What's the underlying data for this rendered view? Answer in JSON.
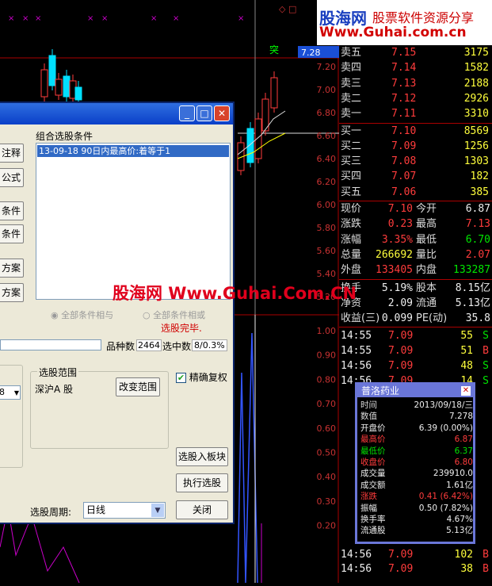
{
  "logo": {
    "cn": "股海网",
    "tagline": "股票软件资源分享",
    "url": "Www.Guhai.com.cn"
  },
  "chart": {
    "price_labels": [
      "7.20",
      "7.00",
      "6.80",
      "6.60",
      "6.40",
      "6.20",
      "6.00",
      "5.80",
      "5.60",
      "5.40",
      "5.20"
    ],
    "vol_labels": [
      "1.00",
      "0.90",
      "0.80",
      "0.70",
      "0.60",
      "0.50",
      "0.40",
      "0.30",
      "0.20"
    ],
    "signal": "突",
    "cursor_price": "7.28",
    "colors": {
      "up": "#ff3c3c",
      "down": "#00e0ff",
      "axis": "#c83232"
    }
  },
  "quote": {
    "asks": [
      {
        "label": "卖五",
        "price": "7.15",
        "vol": "3175"
      },
      {
        "label": "卖四",
        "price": "7.14",
        "vol": "1582"
      },
      {
        "label": "卖三",
        "price": "7.13",
        "vol": "2188"
      },
      {
        "label": "卖二",
        "price": "7.12",
        "vol": "2926"
      },
      {
        "label": "卖一",
        "price": "7.11",
        "vol": "3310"
      }
    ],
    "bids": [
      {
        "label": "买一",
        "price": "7.10",
        "vol": "8569"
      },
      {
        "label": "买二",
        "price": "7.09",
        "vol": "1256"
      },
      {
        "label": "买三",
        "price": "7.08",
        "vol": "1303"
      },
      {
        "label": "买四",
        "price": "7.07",
        "vol": "182"
      },
      {
        "label": "买五",
        "price": "7.06",
        "vol": "385"
      }
    ],
    "stats": [
      {
        "l1": "现价",
        "v1": "7.10",
        "l2": "今开",
        "v2": "6.87",
        "c1": "red",
        "c2": "wht"
      },
      {
        "l1": "涨跌",
        "v1": "0.23",
        "l2": "最高",
        "v2": "7.13",
        "c1": "red",
        "c2": "red"
      },
      {
        "l1": "涨幅",
        "v1": "3.35%",
        "l2": "最低",
        "v2": "6.70",
        "c1": "red",
        "c2": "grn"
      },
      {
        "l1": "总量",
        "v1": "266692",
        "l2": "量比",
        "v2": "2.07",
        "c1": "yel",
        "c2": "red"
      },
      {
        "l1": "外盘",
        "v1": "133405",
        "l2": "内盘",
        "v2": "133287",
        "c1": "red",
        "c2": "grn"
      }
    ],
    "stats2": [
      {
        "l1": "换手",
        "v1": "5.19%",
        "l2": "股本",
        "v2": "8.15亿"
      },
      {
        "l1": "净资",
        "v1": "2.09",
        "l2": "流通",
        "v2": "5.13亿"
      },
      {
        "l1": "收益(三)",
        "v1": "0.099",
        "l2": "PE(动)",
        "v2": "35.8"
      }
    ],
    "ticks": [
      {
        "time": "14:55",
        "price": "7.09",
        "vol": "55",
        "bs": "S"
      },
      {
        "time": "14:55",
        "price": "7.09",
        "vol": "51",
        "bs": "B"
      },
      {
        "time": "14:56",
        "price": "7.09",
        "vol": "48",
        "bs": "S"
      },
      {
        "time": "14:56",
        "price": "7.09",
        "vol": "14",
        "bs": "S"
      },
      {
        "time": "14:56",
        "price": "7.09",
        "vol": "102",
        "bs": "B"
      },
      {
        "time": "14:56",
        "price": "7.09",
        "vol": "38",
        "bs": "B"
      }
    ]
  },
  "dialog": {
    "buttons_left": [
      "注释",
      "公式",
      "条件",
      "条件",
      "方案",
      "方案"
    ],
    "cond_label": "组合选股条件",
    "cond_item": "13-09-18 90日内最高价:着等于1",
    "radio1": "全部条件相与",
    "radio2": "全部条件相或",
    "done": "选股完毕.",
    "count_label": "品种数",
    "count_value": "2464",
    "selected_label": "选中数",
    "selected_value": "8/0.3%",
    "partial_select": "8",
    "range_group": "选股范围",
    "range_value": "深沪A 股",
    "change_range": "改变范围",
    "exact_adjust": "精确复权",
    "add_block": "选股入板块",
    "run": "执行选股",
    "close": "关闭",
    "period_label": "选股周期:",
    "period_value": "日线"
  },
  "popup": {
    "title": "普洛药业",
    "rows": [
      {
        "k": "时间",
        "v": "2013/09/18/三",
        "c": "wht"
      },
      {
        "k": "数值",
        "v": "7.278",
        "c": "wht"
      },
      {
        "k": "开盘价",
        "v": "6.39 (0.00%)",
        "c": "wht"
      },
      {
        "k": "最高价",
        "v": "6.87",
        "c": "red"
      },
      {
        "k": "最低价",
        "v": "6.37",
        "c": "grn"
      },
      {
        "k": "收盘价",
        "v": "6.80",
        "c": "red"
      },
      {
        "k": "成交量",
        "v": "239910.0",
        "c": "wht"
      },
      {
        "k": "成交额",
        "v": "1.61亿",
        "c": "wht"
      },
      {
        "k": "涨跌",
        "v": "0.41 (6.42%)",
        "c": "red"
      },
      {
        "k": "振幅",
        "v": "0.50 (7.82%)",
        "c": "wht"
      },
      {
        "k": "换手率",
        "v": "4.67%",
        "c": "wht"
      },
      {
        "k": "流通股",
        "v": "5.13亿",
        "c": "wht"
      }
    ]
  },
  "watermark": "股海网 Www.Guhai.Com.CN"
}
